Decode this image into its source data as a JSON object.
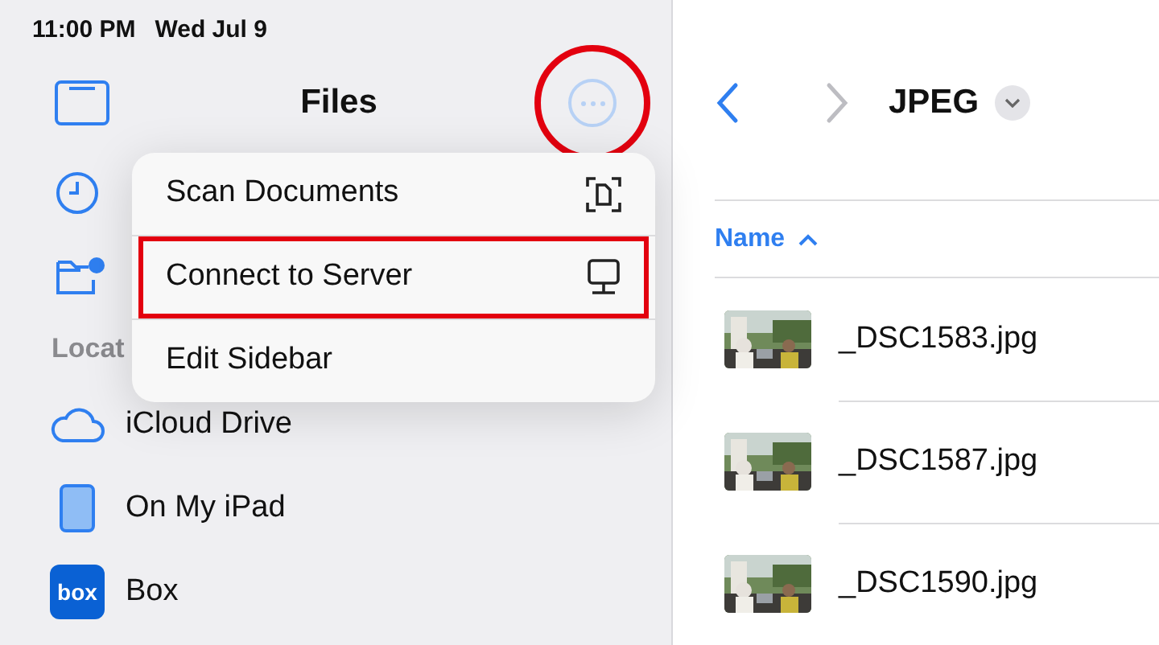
{
  "status_bar": {
    "time": "11:00 PM",
    "date": "Wed Jul 9"
  },
  "sidebar": {
    "title": "Files",
    "more_button": {
      "highlighted": true
    },
    "items": [
      {
        "kind": "recents"
      },
      {
        "kind": "shared"
      }
    ],
    "section": {
      "heading": "Locat",
      "items": [
        {
          "label": "iCloud Drive",
          "kind": "cloud"
        },
        {
          "label": "On My iPad",
          "kind": "ipad"
        },
        {
          "label": "Box",
          "kind": "box",
          "logo_text": "box"
        }
      ]
    }
  },
  "menu": {
    "items": [
      {
        "label": "Scan Documents",
        "kind": "scan",
        "highlighted": false
      },
      {
        "label": "Connect to Server",
        "kind": "server",
        "highlighted": true
      },
      {
        "label": "Edit Sidebar",
        "kind": "plain",
        "highlighted": false
      }
    ]
  },
  "browser": {
    "title": "JPEG",
    "sort": {
      "label": "Name",
      "ascending": true
    },
    "files": [
      {
        "name": "_DSC1583.jpg",
        "kind": "picture"
      },
      {
        "name": "_DSC1587.jpg",
        "kind": "picture"
      },
      {
        "name": "_DSC1590.jpg",
        "kind": "picture"
      }
    ]
  }
}
